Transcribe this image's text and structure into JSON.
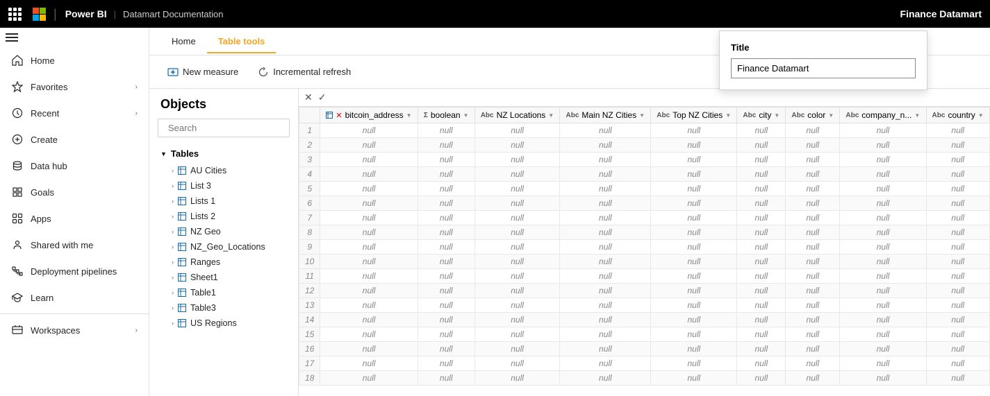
{
  "topbar": {
    "app_name": "Power BI",
    "doc_name": "Datamart Documentation",
    "title": "Finance Datamart"
  },
  "tabs": [
    {
      "label": "Home",
      "active": false
    },
    {
      "label": "Table tools",
      "active": true
    }
  ],
  "toolbar": {
    "new_measure_label": "New measure",
    "incremental_refresh_label": "Incremental refresh"
  },
  "objects_panel": {
    "title": "Objects",
    "search_placeholder": "Search",
    "tables_label": "Tables",
    "tables": [
      "AU Cities",
      "List 3",
      "Lists 1",
      "Lists 2",
      "NZ Geo",
      "NZ_Geo_Locations",
      "Ranges",
      "Sheet1",
      "Table1",
      "Table3",
      "US Regions"
    ]
  },
  "sidebar": {
    "items": [
      {
        "label": "Home",
        "icon": "home-icon"
      },
      {
        "label": "Favorites",
        "icon": "star-icon",
        "has_chevron": true
      },
      {
        "label": "Recent",
        "icon": "clock-icon",
        "has_chevron": true
      },
      {
        "label": "Create",
        "icon": "plus-icon"
      },
      {
        "label": "Data hub",
        "icon": "database-icon"
      },
      {
        "label": "Goals",
        "icon": "goals-icon"
      },
      {
        "label": "Apps",
        "icon": "apps-icon"
      },
      {
        "label": "Shared with me",
        "icon": "shared-icon"
      },
      {
        "label": "Deployment pipelines",
        "icon": "pipeline-icon"
      },
      {
        "label": "Learn",
        "icon": "learn-icon"
      },
      {
        "label": "Workspaces",
        "icon": "workspaces-icon",
        "has_chevron": true
      }
    ]
  },
  "grid": {
    "columns": [
      {
        "type": "table",
        "name": "bitcoin_address",
        "has_x": true
      },
      {
        "type": "sigma",
        "name": "boolean",
        "has_x": false
      },
      {
        "type": "abc",
        "name": "NZ Locations",
        "has_x": false
      },
      {
        "type": "abc",
        "name": "Main NZ Cities",
        "has_x": false
      },
      {
        "type": "abc",
        "name": "Top NZ Cities",
        "has_x": false
      },
      {
        "type": "abc",
        "name": "city",
        "has_x": false
      },
      {
        "type": "abc",
        "name": "color",
        "has_x": false
      },
      {
        "type": "abc",
        "name": "company_n...",
        "has_x": false
      },
      {
        "type": "abc",
        "name": "country",
        "has_x": false
      }
    ],
    "row_count": 18,
    "null_value": "null"
  },
  "title_popup": {
    "label": "Title",
    "value": "Finance Datamart"
  }
}
